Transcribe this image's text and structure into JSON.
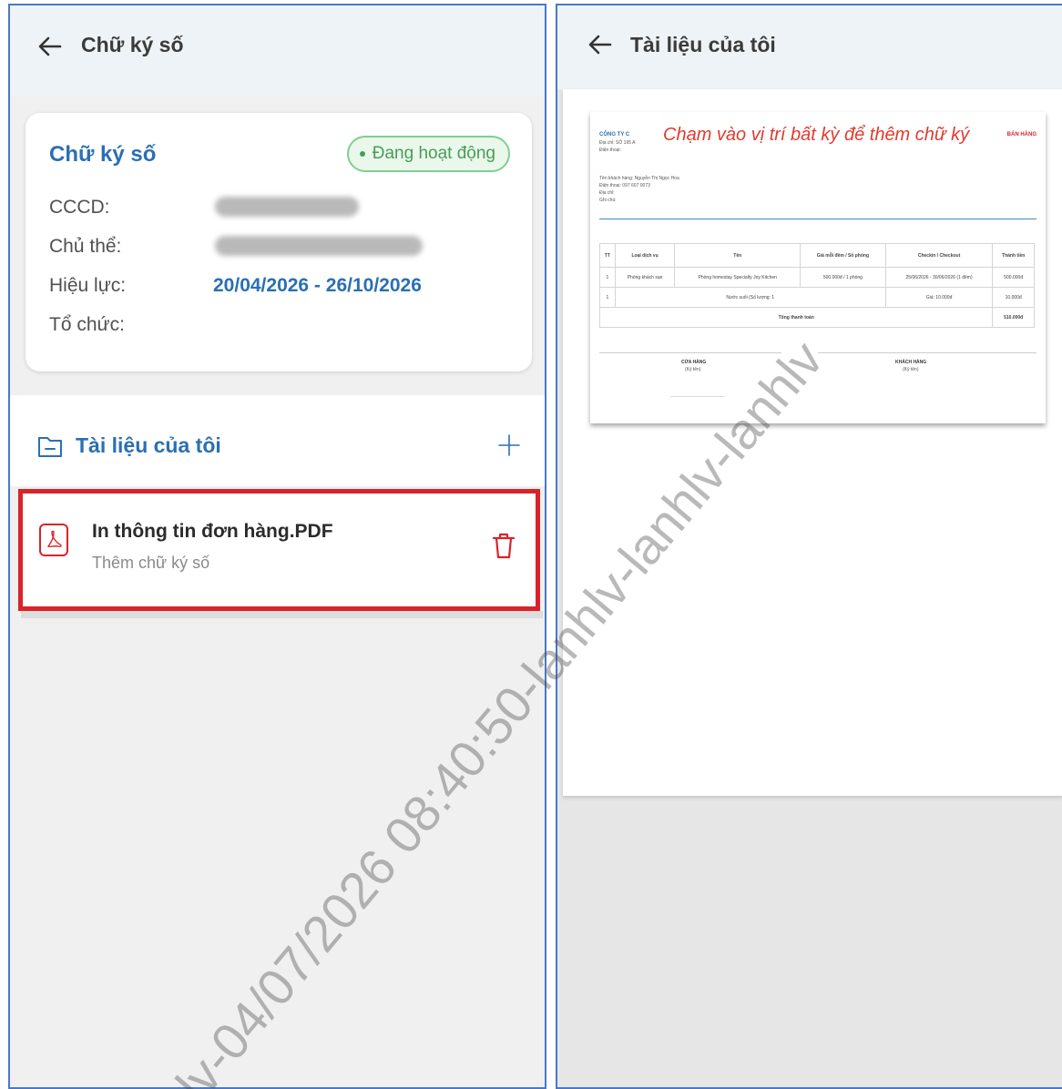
{
  "left": {
    "appbar": {
      "title": "Chữ ký số"
    },
    "card": {
      "title": "Chữ ký số",
      "status": "Đang hoạt động",
      "rows": [
        {
          "label": "CCCD:"
        },
        {
          "label": "Chủ thể:"
        },
        {
          "label": "Hiệu lực:",
          "value": "20/04/2026 - 26/10/2026"
        },
        {
          "label": "Tổ chức:"
        }
      ]
    },
    "documents": {
      "title": "Tài liệu của tôi"
    },
    "file": {
      "name": "In thông tin đơn hàng.PDF",
      "subtitle": "Thêm chữ ký số"
    }
  },
  "right": {
    "appbar": {
      "title": "Tài liệu của tôi"
    },
    "preview": {
      "hint": "Chạm vào vị trí bất kỳ để thêm chữ ký",
      "company": "CÔNG TY C",
      "header_right": "BÁN HÀNG",
      "address": "Địa chỉ: SỐ 195 A",
      "phone_label": "Điện thoại:",
      "customer": "Tên khách hàng: Nguyễn Thị Ngọc Hoa",
      "customer_phone": "Điện thoại: 097 607 0073",
      "customer_addr": "Địa chỉ:",
      "customer_note": "Ghi chú:",
      "table_headers": [
        "TT",
        "Loại dịch vụ",
        "Tên",
        "Giá mỗi đêm / Số phòng",
        "Checkin / Checkout",
        "Thành tiền"
      ],
      "table_rows": [
        [
          "1",
          "Phòng khách sạn",
          "Phòng homestay Specialty Joy Kitchen",
          "500.000đ / 1 phòng",
          "25/06/2026 - 30/06/2026 (1 đêm)",
          "500.000đ"
        ],
        [
          "1",
          "",
          "Nước suối (Số lượng: 1",
          "",
          "Giá: 10.000đ",
          "10.000đ"
        ]
      ],
      "total_label": "Tổng thanh toán",
      "total_value": "510.000đ",
      "sign_left": "CỬA HÀNG",
      "sign_left_sub": "(Ký tên)",
      "sign_right": "KHÁCH HÀNG",
      "sign_right_sub": "(Ký tên)"
    }
  },
  "watermark": "lv-04/07/2026 08:40:50-lanhlv-lanhlv-lanhlv",
  "colors": {
    "frame": "#4a78c9",
    "accent": "#2a6fb4",
    "highlight": "#d9232a",
    "status": "#4a9b58",
    "hint": "#e23a2e"
  },
  "icons": [
    "back-arrow-icon",
    "folder-icon",
    "plus-icon",
    "pdf-file-icon",
    "trash-icon"
  ]
}
